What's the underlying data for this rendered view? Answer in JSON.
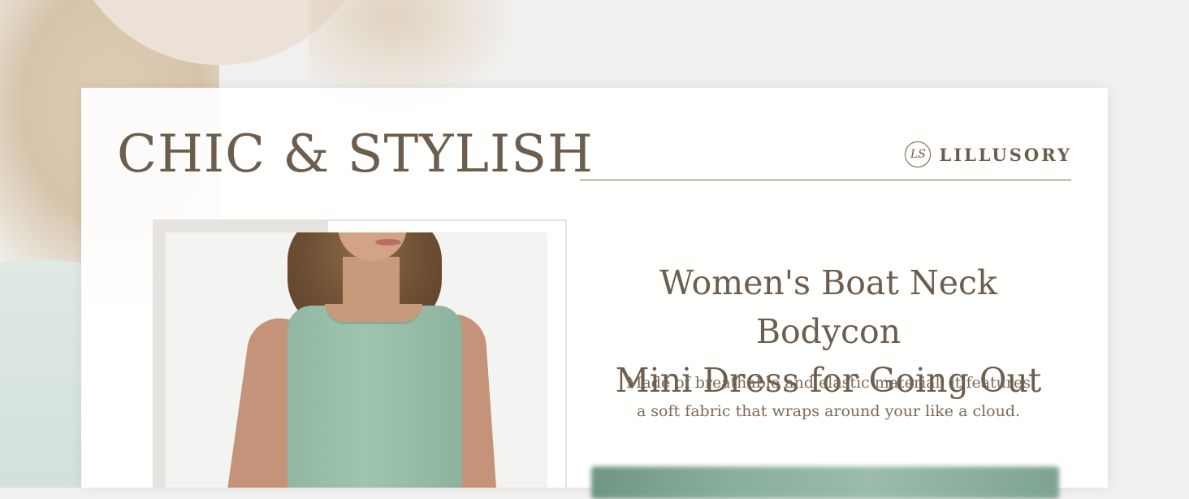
{
  "headline": "CHIC & STYLISH",
  "brand": {
    "logo_text": "LS",
    "name": "LILLUSORY"
  },
  "product": {
    "title_line1": "Women's Boat Neck Bodycon",
    "title_line2": "Mini Dress for Going Out",
    "description_line1": "Made of breathable and elastic material, it features",
    "description_line2": "a soft fabric that wraps around your like a cloud."
  },
  "colors": {
    "text_brown": "#6d5d4d",
    "dress_sage": "#9fc4b0",
    "card_bg": "#ffffff"
  },
  "icons": {
    "brand_logo": "ls-monogram-icon"
  }
}
